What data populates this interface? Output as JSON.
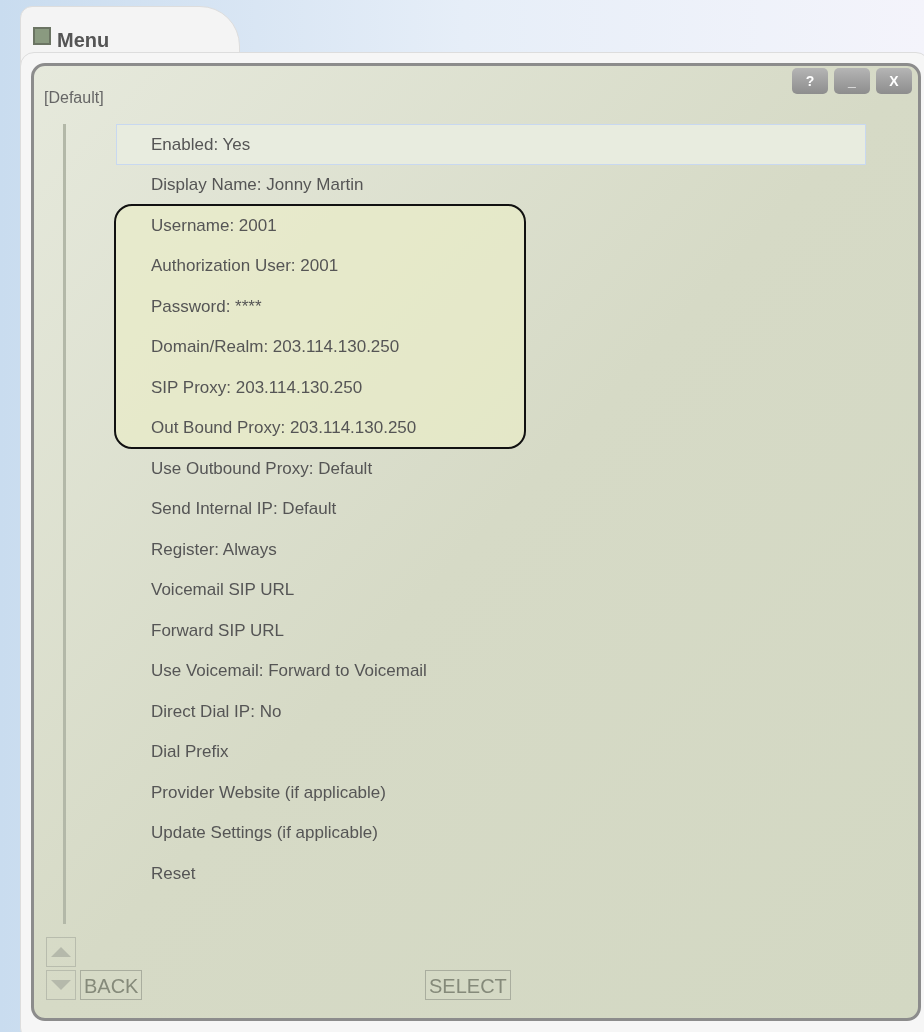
{
  "tab": {
    "title": "Menu"
  },
  "window_buttons": [
    "?",
    "_",
    "X"
  ],
  "screen": {
    "heading": "[Default]",
    "items_above": [
      {
        "label": "Enabled: Yes",
        "selected": true
      },
      {
        "label": "Display Name: Jonny Martin",
        "selected": false
      }
    ],
    "highlighted_items": [
      {
        "label": "Username: 2001",
        "selected": false
      },
      {
        "label": "Authorization User: 2001",
        "selected": false
      },
      {
        "label": "Password: ****",
        "selected": false
      },
      {
        "label": "Domain/Realm: 203.114.130.250",
        "selected": false
      },
      {
        "label": "SIP Proxy: 203.114.130.250",
        "selected": false
      },
      {
        "label": "Out Bound Proxy: 203.114.130.250",
        "selected": false
      }
    ],
    "items_below": [
      {
        "label": "Use Outbound Proxy: Default",
        "selected": false
      },
      {
        "label": "Send Internal IP: Default",
        "selected": false
      },
      {
        "label": "Register: Always",
        "selected": false
      },
      {
        "label": "Voicemail SIP URL",
        "selected": false
      },
      {
        "label": "Forward SIP URL",
        "selected": false
      },
      {
        "label": "Use Voicemail: Forward to Voicemail",
        "selected": false
      },
      {
        "label": "Direct Dial IP: No",
        "selected": false
      },
      {
        "label": "Dial Prefix",
        "selected": false
      },
      {
        "label": "Provider Website (if applicable)",
        "selected": false
      },
      {
        "label": "Update Settings (if applicable)",
        "selected": false
      },
      {
        "label": "Reset",
        "selected": false
      }
    ]
  },
  "softkeys": [
    {
      "label": "BACK",
      "disabled": true
    },
    {
      "label": "SELECT",
      "disabled": true
    }
  ]
}
